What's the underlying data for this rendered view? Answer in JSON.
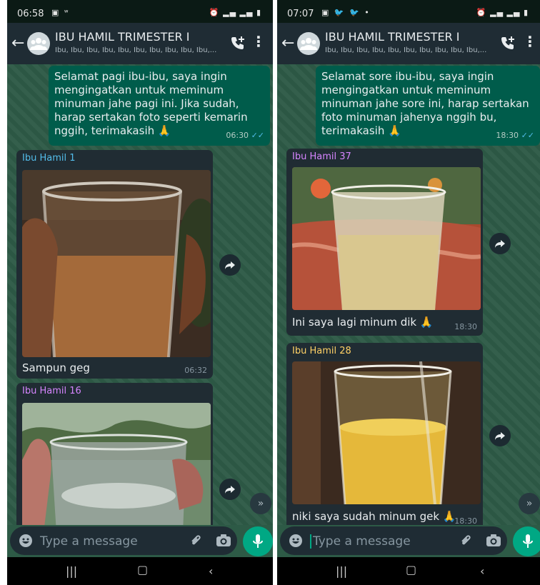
{
  "left": {
    "status": {
      "time": "06:58"
    },
    "header": {
      "title": "IBU HAMIL TRIMESTER I",
      "subtitle": "Ibu, Ibu, Ibu, Ibu, Ibu, Ibu, Ibu, Ibu, Ibu, Ibu,..."
    },
    "outgoing": {
      "text": "Selamat pagi ibu-ibu, saya ingin mengingatkan untuk meminum minuman jahe pagi ini. Jika sudah, harap sertakan foto seperti kemarin nggih, terimakasih 🙏",
      "time": "06:30"
    },
    "messages": [
      {
        "sender": "Ibu Hamil 1",
        "sender_color": "#53bdeb",
        "caption": "Sampun geg",
        "time": "06:32"
      },
      {
        "sender": "Ibu Hamil 16",
        "sender_color": "#d685ff",
        "caption": "",
        "time": ""
      }
    ],
    "input": {
      "placeholder": "Type a message"
    }
  },
  "right": {
    "status": {
      "time": "07:07"
    },
    "header": {
      "title": "IBU HAMIL TRIMESTER I",
      "subtitle": "Ibu, Ibu, Ibu, Ibu, Ibu, Ibu, Ibu, Ibu, Ibu, Ibu,..."
    },
    "outgoing": {
      "text": "Selamat sore ibu-ibu, saya ingin mengingatkan untuk meminum minuman jahe sore ini, harap sertakan foto minuman jahenya nggih bu, terimakasih 🙏",
      "time": "18:30"
    },
    "messages": [
      {
        "sender": "Ibu Hamil 37",
        "sender_color": "#d685ff",
        "caption": "Ini saya lagi minum dik 🙏",
        "time": "18:30"
      },
      {
        "sender": "Ibu Hamil 28",
        "sender_color": "#ffd166",
        "caption": "niki saya sudah minum gek 🙏",
        "time": "18:30"
      }
    ],
    "input": {
      "placeholder": "Type a message"
    }
  },
  "colors": {
    "header": "#1f2c34",
    "chat_bg": "#2d5a46",
    "outgoing_bubble": "#005c4b",
    "incoming_bubble": "#202c33",
    "accent": "#00a884",
    "read_ticks": "#53bdeb"
  },
  "icons": [
    "back-arrow-icon",
    "group-avatar-icon",
    "add-call-icon",
    "more-vert-icon",
    "forward-icon",
    "scroll-down-icon",
    "emoji-icon",
    "attach-icon",
    "camera-icon",
    "mic-icon",
    "recents-nav-icon",
    "home-nav-icon",
    "back-nav-icon"
  ]
}
